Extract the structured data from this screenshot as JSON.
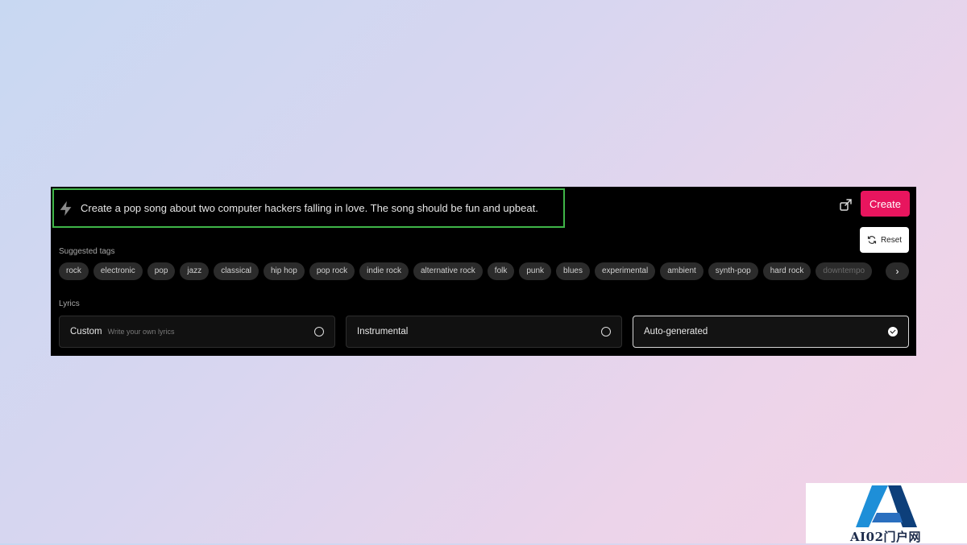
{
  "prompt": {
    "text": "Create a pop song about two computer hackers falling in love. The song should be fun and upbeat."
  },
  "actions": {
    "create_label": "Create",
    "reset_label": "Reset"
  },
  "suggested_tags": {
    "label": "Suggested tags",
    "items": [
      "rock",
      "electronic",
      "pop",
      "jazz",
      "classical",
      "hip hop",
      "pop rock",
      "indie rock",
      "alternative rock",
      "folk",
      "punk",
      "blues",
      "experimental",
      "ambient",
      "synth-pop",
      "hard rock",
      "downtempo"
    ]
  },
  "lyrics": {
    "label": "Lyrics",
    "options": [
      {
        "title": "Custom",
        "subtitle": "Write your own lyrics",
        "selected": false
      },
      {
        "title": "Instrumental",
        "subtitle": "",
        "selected": false
      },
      {
        "title": "Auto-generated",
        "subtitle": "",
        "selected": true
      }
    ]
  },
  "colors": {
    "accent": "#e8155e",
    "highlight_border": "#3fb548"
  },
  "watermark": {
    "text": "AI02门户网"
  }
}
